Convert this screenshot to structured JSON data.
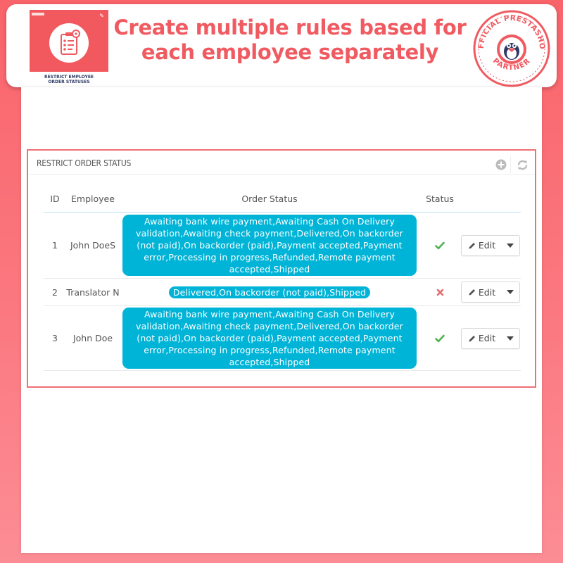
{
  "banner": {
    "headline_line1": "Create multiple rules based for",
    "headline_line2": "each employee separately",
    "thumb_caption_line1": "RESTRICT EMPLOYEE",
    "thumb_caption_line2": "ORDER STATUSES",
    "seal_top_text": "OFFICIAL PRESTASHOP",
    "seal_bottom_text": "PARTNER"
  },
  "panel": {
    "title": "RESTRICT ORDER STATUS",
    "add_icon": "plus-circle-icon",
    "refresh_icon": "refresh-icon"
  },
  "table": {
    "headers": {
      "id": "ID",
      "employee": "Employee",
      "order_status": "Order Status",
      "status": "Status"
    },
    "rows": [
      {
        "id": "1",
        "employee": "John DoeS",
        "order_status": "Awaiting bank wire payment,Awaiting Cash On Delivery validation,Awaiting check payment,Delivered,On backorder (not paid),On backorder (paid),Payment accepted,Payment error,Processing in progress,Refunded,Remote payment accepted,Shipped",
        "status": "enabled",
        "status_icon": "check-icon",
        "edit_label": "Edit"
      },
      {
        "id": "2",
        "employee": "Translator N",
        "order_status": "Delivered,On backorder (not paid),Shipped",
        "status": "disabled",
        "status_icon": "cross-icon",
        "edit_label": "Edit"
      },
      {
        "id": "3",
        "employee": "John Doe",
        "order_status": "Awaiting bank wire payment,Awaiting Cash On Delivery validation,Awaiting check payment,Delivered,On backorder (not paid),On backorder (paid),Payment accepted,Payment error,Processing in progress,Refunded,Remote payment accepted,Shipped",
        "status": "enabled",
        "status_icon": "check-icon",
        "edit_label": "Edit"
      }
    ]
  },
  "colors": {
    "brand": "#f05a61",
    "pill": "#00b4d8",
    "enabled": "#4fb050",
    "disabled": "#e36b72"
  }
}
